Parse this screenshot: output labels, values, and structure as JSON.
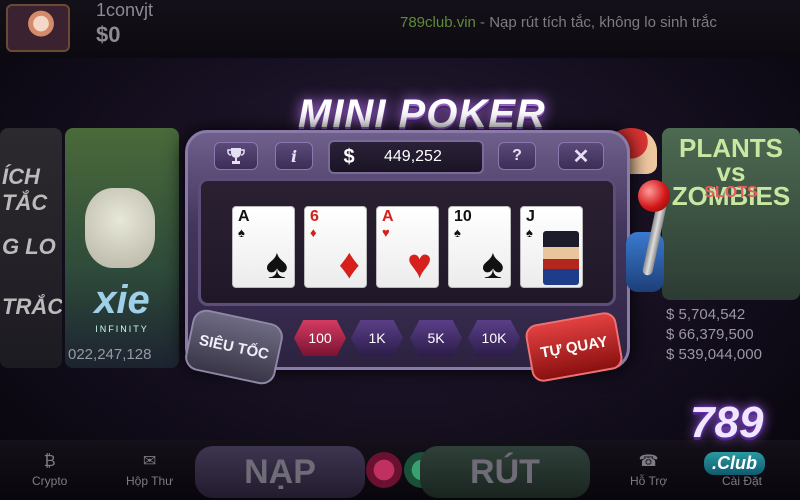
{
  "user": {
    "name": "1convjt",
    "balance": "$0"
  },
  "ticker": {
    "site": "789club.vin",
    "message": " - Nạp rút tích tắc, không lo sinh trắc"
  },
  "banners": {
    "left_lines": [
      "ÍCH TẮC",
      "G LO",
      "TRẮC"
    ],
    "axie_logo": "xie",
    "axie_sub": "INFINITY",
    "axie_amount": "022,247,128",
    "pvz_title": "PLANTS vs ZOMBIES",
    "pvz_sub": "SLOTS",
    "pvz_jackpots": [
      "$ 5,704,542",
      "$ 66,379,500",
      "$ 539,044,000"
    ]
  },
  "game": {
    "title": "MINI POKER",
    "jackpot": "449,252",
    "jackpot_icon": "$",
    "tabs": {
      "trophy_icon": "trophy-icon",
      "info": "i",
      "help": "?",
      "close": "✕"
    },
    "cards": [
      {
        "rank": "A",
        "suit": "♠",
        "color": "black"
      },
      {
        "rank": "6",
        "suit": "♦",
        "color": "red"
      },
      {
        "rank": "A",
        "suit": "♥",
        "color": "red"
      },
      {
        "rank": "10",
        "suit": "♠",
        "color": "black"
      },
      {
        "rank": "J",
        "suit": "♠",
        "color": "black",
        "face": true
      }
    ],
    "speed_label": "SIÊU TỐC",
    "bets": [
      "100",
      "1K",
      "5K",
      "10K"
    ],
    "selected_bet": "100",
    "auto_label": "TỰ QUAY"
  },
  "nav": {
    "crypto": "Crypto",
    "inbox": "Hộp Thư",
    "deposit": "NẠP",
    "withdraw": "RÚT",
    "support": "Hỗ Trợ",
    "settings": "Cài Đặt"
  },
  "brand": {
    "logo": "789",
    "logo_sub": ".Club"
  },
  "colors": {
    "accent_red": "#d43b62",
    "panel_purple": "#43365c",
    "ticker_green": "#5f8a3a"
  }
}
